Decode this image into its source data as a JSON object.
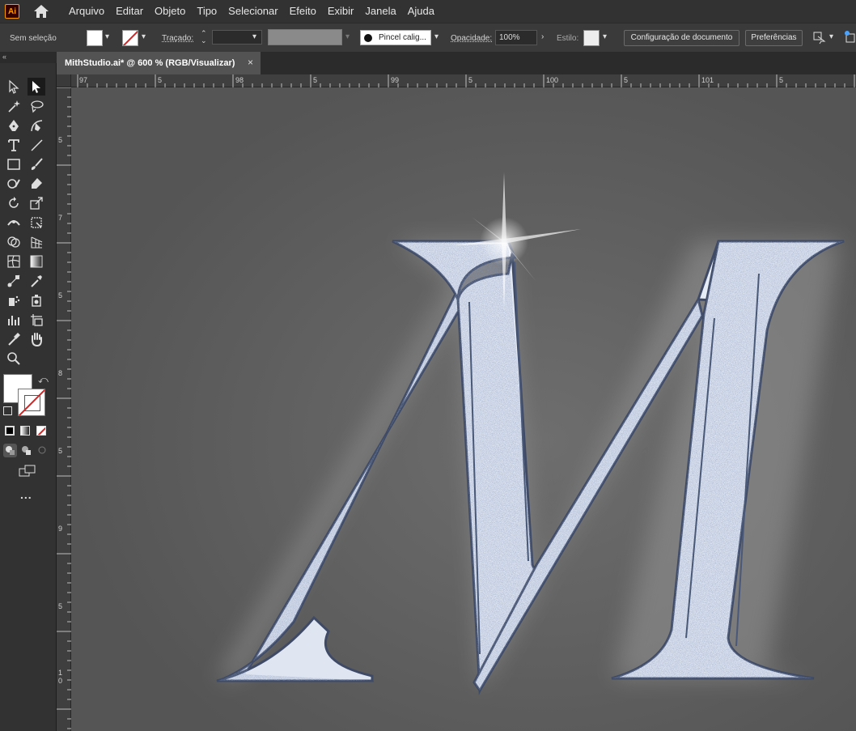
{
  "app": {
    "logo": "Ai"
  },
  "menu": [
    "Arquivo",
    "Editar",
    "Objeto",
    "Tipo",
    "Selecionar",
    "Efeito",
    "Exibir",
    "Janela",
    "Ajuda"
  ],
  "control": {
    "selection_label": "Sem seleção",
    "stroke_label": "Traçado:",
    "brush": "Pincel calig...",
    "opacity_label": "Opacidade:",
    "opacity_value": "100%",
    "style_label": "Estilo:",
    "doc_setup": "Configuração de documento",
    "prefs": "Preferências"
  },
  "document": {
    "tab": "MithStudio.ai* @ 600 % (RGB/Visualizar)",
    "close": "×"
  },
  "toolbar": {
    "collapse": "«",
    "more": "..."
  },
  "ruler": {
    "horizontal": [
      "97",
      "5",
      "98",
      "5",
      "99",
      "5",
      "100",
      "5",
      "101",
      "5"
    ],
    "vertical": [
      "5",
      "7",
      "5",
      "8",
      "5",
      "9",
      "5",
      "1\n0"
    ]
  },
  "colors": {
    "accent": "#ff9a00",
    "letter_fill": "#e6ecf6",
    "letter_edge": "#4a5878",
    "canvas": "#575757"
  },
  "icons": [
    "home-icon",
    "selection-tool-icon",
    "direct-selection-tool-icon",
    "pen-tool-icon",
    "type-tool-icon",
    "line-tool-icon",
    "rectangle-tool-icon",
    "brush-tool-icon",
    "eraser-tool-icon",
    "rotate-tool-icon",
    "scale-tool-icon",
    "gradient-tool-icon",
    "eyedropper-tool-icon",
    "chart-tool-icon",
    "artboard-tool-icon",
    "hand-tool-icon",
    "zoom-tool-icon"
  ]
}
